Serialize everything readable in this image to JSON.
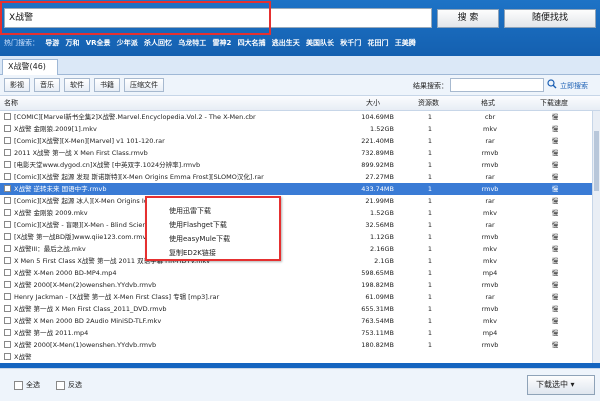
{
  "search": {
    "query": "X战警",
    "search_label": "搜 索",
    "random_label": "随便找找"
  },
  "hot": {
    "label": "热门搜索：",
    "items": [
      "导游",
      "万和",
      "VR全景",
      "少年派",
      "杀人回忆",
      "乌龙特工",
      "雷神2",
      "四大名捕",
      "逃出生天",
      "美国队长",
      "秋千门",
      "花田门",
      "王美腾"
    ]
  },
  "tab": {
    "label": "X战警(46)"
  },
  "filters": {
    "buttons": [
      "影视",
      "音乐",
      "软件",
      "书籍",
      "压缩文件"
    ],
    "result_search_label": "结果搜索：",
    "now_search_label": "立即搜索"
  },
  "columns": {
    "name": "名称",
    "size": "大小",
    "count": "资源数",
    "format": "格式",
    "speed": "下载速度"
  },
  "rows": [
    {
      "name": "[COMIC][Marvel新书全集2]X战警.Marvel.Encyclopedia.Vol.2 - The X-Men.cbr",
      "size": "104.69MB",
      "count": "1",
      "format": "cbr",
      "speed": "慢"
    },
    {
      "name": "X战警 金刚狼.2009[1].mkv",
      "size": "1.52GB",
      "count": "1",
      "format": "mkv",
      "speed": "慢"
    },
    {
      "name": "[Comic][X战警][X-Men][Marvel] v1 101-120.rar",
      "size": "221.40MB",
      "count": "1",
      "format": "rar",
      "speed": "慢"
    },
    {
      "name": "2011 X战警 第一战 X Men First Class.rmvb",
      "size": "732.89MB",
      "count": "1",
      "format": "rmvb",
      "speed": "慢"
    },
    {
      "name": "[电影天堂www.dygod.cn]X战警 [中英双字.1024分辨率].rmvb",
      "size": "899.92MB",
      "count": "1",
      "format": "rmvb",
      "speed": "慢"
    },
    {
      "name": "[Comic][X战警 起源 发现 斯诺斯特][X-Men Origins Emma Frost][SLOMO汉化].rar",
      "size": "27.27MB",
      "count": "1",
      "format": "rar",
      "speed": "慢"
    },
    {
      "name": "X战警 逆转未来 国语中字.rmvb",
      "size": "433.74MB",
      "count": "1",
      "format": "rmvb",
      "speed": "慢"
    },
    {
      "name": "[Comic][X战警 起源 冰人][X-Men Origins Iceman].rar",
      "size": "21.99MB",
      "count": "1",
      "format": "rar",
      "speed": "慢"
    },
    {
      "name": "X战警 金刚狼 2009.mkv",
      "size": "1.52GB",
      "count": "1",
      "format": "mkv",
      "speed": "慢"
    },
    {
      "name": "[Comic][X战警 - 盲眼][X-Men - Blind Science].rar",
      "size": "32.56MB",
      "count": "1",
      "format": "rar",
      "speed": "慢"
    },
    {
      "name": "[X战警 第一战BD版]www.qiie123.com.rmvb",
      "size": "1.12GB",
      "count": "1",
      "format": "rmvb",
      "speed": "慢"
    },
    {
      "name": "X战警III：最后之战.mkv",
      "size": "2.16GB",
      "count": "1",
      "format": "mkv",
      "speed": "慢"
    },
    {
      "name": "X Men 5 First Class X战警 第一战 2011 双语字幕 HR-HDTV.mkv",
      "size": "2.1GB",
      "count": "1",
      "format": "mkv",
      "speed": "慢"
    },
    {
      "name": "X战警 X-Men 2000 BD-MP4.mp4",
      "size": "598.65MB",
      "count": "1",
      "format": "mp4",
      "speed": "慢"
    },
    {
      "name": "X战警 2000[X-Men(2)owenshen.YYdvb.rmvb",
      "size": "198.82MB",
      "count": "1",
      "format": "rmvb",
      "speed": "慢"
    },
    {
      "name": "Henry Jackman - [X战警 第一战 X-Men First Class] 专辑 [mp3].rar",
      "size": "61.09MB",
      "count": "1",
      "format": "rar",
      "speed": "慢"
    },
    {
      "name": "X战警 第一战 X Men First Class_2011_DVD.rmvb",
      "size": "655.31MB",
      "count": "1",
      "format": "rmvb",
      "speed": "慢"
    },
    {
      "name": "X战警 X Men 2000 BD 2Audio MiniSD-TLF.mkv",
      "size": "763.54MB",
      "count": "1",
      "format": "mkv",
      "speed": "慢"
    },
    {
      "name": "X战警 第一战 2011.mp4",
      "size": "753.11MB",
      "count": "1",
      "format": "mp4",
      "speed": "慢"
    },
    {
      "name": "X战警 2000[X-Men(1)owenshen.YYdvb.rmvb",
      "size": "180.82MB",
      "count": "1",
      "format": "rmvb",
      "speed": "慢"
    },
    {
      "name": "X战警",
      "size": "",
      "count": "",
      "format": "",
      "speed": ""
    }
  ],
  "selected_row": 6,
  "context_menu": {
    "items": [
      "使用迅雷下载",
      "使用Flashget下载",
      "使用easyMule下载",
      "复制ED2K链接"
    ]
  },
  "bottom": {
    "select_all": "全选",
    "invert": "反选",
    "download_selected": "下载选中"
  },
  "colors": {
    "accent": "#1565c0",
    "highlight": "#e53030",
    "selection": "#3a7bd5"
  }
}
